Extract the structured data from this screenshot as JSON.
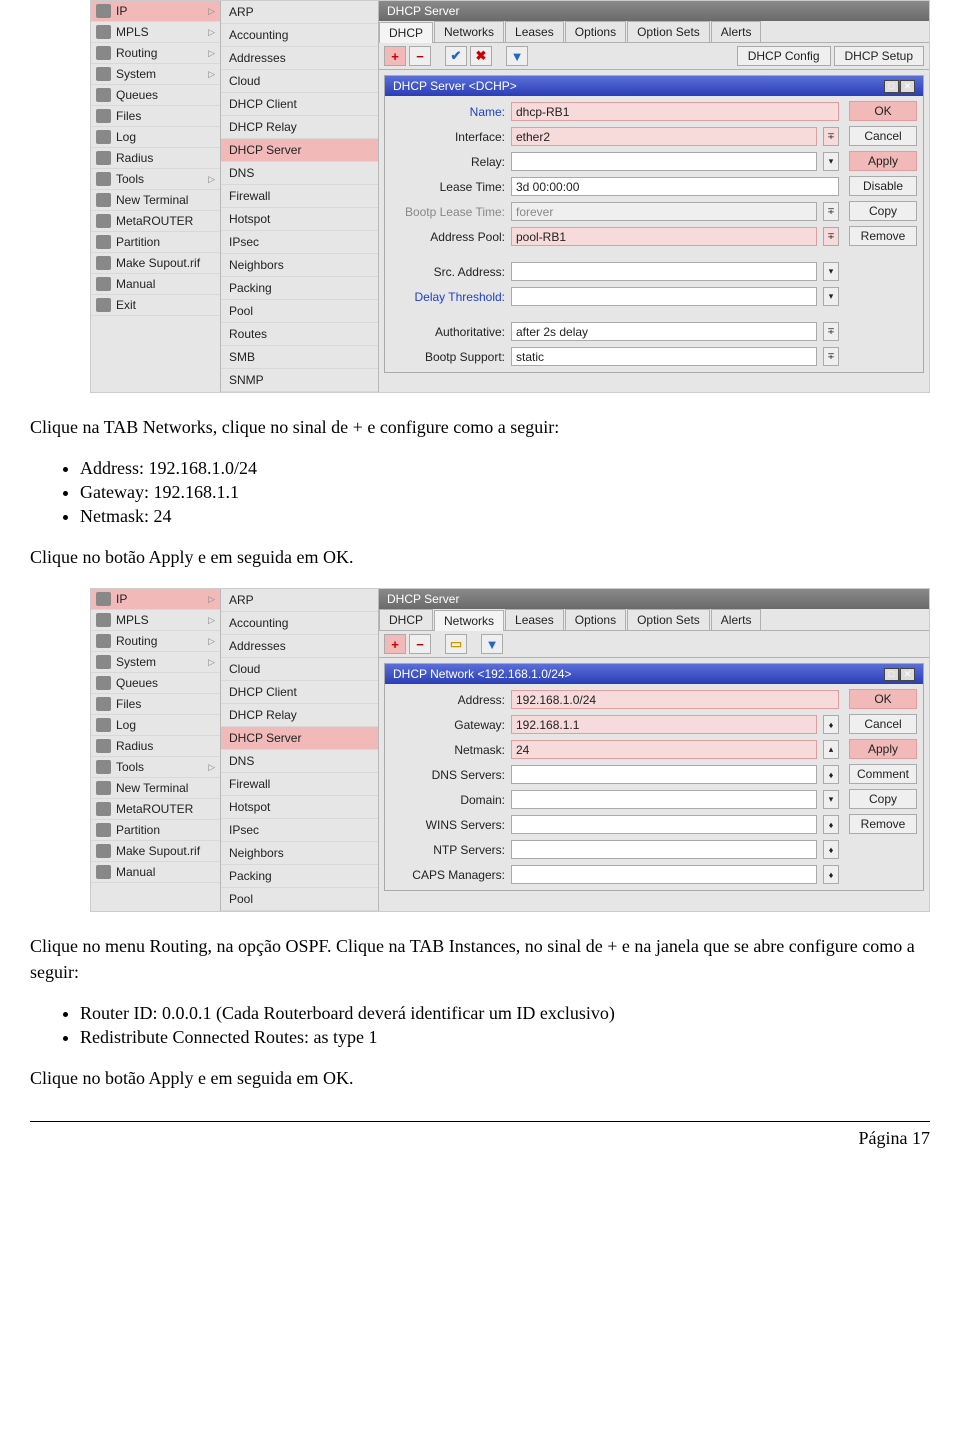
{
  "shot1": {
    "sidebar": {
      "items": [
        {
          "label": "IP",
          "hot": true,
          "arrow": true
        },
        {
          "label": "MPLS",
          "arrow": true
        },
        {
          "label": "Routing",
          "arrow": true
        },
        {
          "label": "System",
          "arrow": true
        },
        {
          "label": "Queues"
        },
        {
          "label": "Files"
        },
        {
          "label": "Log"
        },
        {
          "label": "Radius"
        },
        {
          "label": "Tools",
          "arrow": true
        },
        {
          "label": "New Terminal"
        },
        {
          "label": "MetaROUTER"
        },
        {
          "label": "Partition"
        },
        {
          "label": "Make Supout.rif"
        },
        {
          "label": "Manual"
        },
        {
          "label": "Exit"
        }
      ]
    },
    "submenu": {
      "items": [
        "ARP",
        "Accounting",
        "Addresses",
        "Cloud",
        "DHCP Client",
        "DHCP Relay",
        "DHCP Server",
        "DNS",
        "Firewall",
        "Hotspot",
        "IPsec",
        "Neighbors",
        "Packing",
        "Pool",
        "Routes",
        "SMB",
        "SNMP"
      ],
      "hot": "DHCP Server"
    },
    "panel_title": "DHCP Server",
    "tabs": [
      "DHCP",
      "Networks",
      "Leases",
      "Options",
      "Option Sets",
      "Alerts"
    ],
    "tabs_active": "DHCP",
    "cfg_btn": "DHCP Config",
    "setup_btn": "DHCP Setup",
    "dialog_title": "DHCP Server <DCHP>",
    "fields": {
      "name_lbl": "Name:",
      "name_val": "dhcp-RB1",
      "iface_lbl": "Interface:",
      "iface_val": "ether2",
      "relay_lbl": "Relay:",
      "relay_val": "",
      "lease_lbl": "Lease Time:",
      "lease_val": "3d 00:00:00",
      "blease_lbl": "Bootp Lease Time:",
      "blease_val": "forever",
      "pool_lbl": "Address Pool:",
      "pool_val": "pool-RB1",
      "src_lbl": "Src. Address:",
      "src_val": "",
      "delay_lbl": "Delay Threshold:",
      "delay_val": "",
      "auth_lbl": "Authoritative:",
      "auth_val": "after 2s delay",
      "bsup_lbl": "Bootp Support:",
      "bsup_val": "static"
    },
    "btns": [
      "OK",
      "Cancel",
      "Apply",
      "Disable",
      "Copy",
      "Remove"
    ]
  },
  "text1": {
    "p1": "Clique na TAB Networks, clique no sinal de + e configure como a seguir:",
    "b1": "Address: 192.168.1.0/24",
    "b2": "Gateway: 192.168.1.1",
    "b3": "Netmask: 24",
    "p2": "Clique no botão Apply e em seguida em OK."
  },
  "shot2": {
    "sidebar": {
      "items": [
        {
          "label": "IP",
          "hot": true,
          "arrow": true
        },
        {
          "label": "MPLS",
          "arrow": true
        },
        {
          "label": "Routing",
          "arrow": true
        },
        {
          "label": "System",
          "arrow": true
        },
        {
          "label": "Queues"
        },
        {
          "label": "Files"
        },
        {
          "label": "Log"
        },
        {
          "label": "Radius"
        },
        {
          "label": "Tools",
          "arrow": true
        },
        {
          "label": "New Terminal"
        },
        {
          "label": "MetaROUTER"
        },
        {
          "label": "Partition"
        },
        {
          "label": "Make Supout.rif"
        },
        {
          "label": "Manual"
        }
      ]
    },
    "submenu": {
      "items": [
        "ARP",
        "Accounting",
        "Addresses",
        "Cloud",
        "DHCP Client",
        "DHCP Relay",
        "DHCP Server",
        "DNS",
        "Firewall",
        "Hotspot",
        "IPsec",
        "Neighbors",
        "Packing",
        "Pool"
      ],
      "hot": "DHCP Server"
    },
    "panel_title": "DHCP Server",
    "tabs": [
      "DHCP",
      "Networks",
      "Leases",
      "Options",
      "Option Sets",
      "Alerts"
    ],
    "tabs_active": "Networks",
    "dialog_title": "DHCP Network <192.168.1.0/24>",
    "fields": {
      "addr_lbl": "Address:",
      "addr_val": "192.168.1.0/24",
      "gw_lbl": "Gateway:",
      "gw_val": "192.168.1.1",
      "nm_lbl": "Netmask:",
      "nm_val": "24",
      "dns_lbl": "DNS Servers:",
      "dns_val": "",
      "dom_lbl": "Domain:",
      "dom_val": "",
      "wins_lbl": "WINS Servers:",
      "wins_val": "",
      "ntp_lbl": "NTP Servers:",
      "ntp_val": "",
      "caps_lbl": "CAPS Managers:",
      "caps_val": ""
    },
    "btns": [
      "OK",
      "Cancel",
      "Apply",
      "Comment",
      "Copy",
      "Remove"
    ]
  },
  "text2": {
    "p1": "Clique no menu Routing, na opção OSPF. Clique na TAB Instances, no sinal de + e na janela que se abre configure como a seguir:",
    "b1": "Router ID: 0.0.0.1 (Cada Routerboard deverá identificar um ID exclusivo)",
    "b2": "Redistribute Connected Routes: as type 1",
    "p2": "Clique no botão Apply e em seguida em OK."
  },
  "pagenum": "Página 17"
}
